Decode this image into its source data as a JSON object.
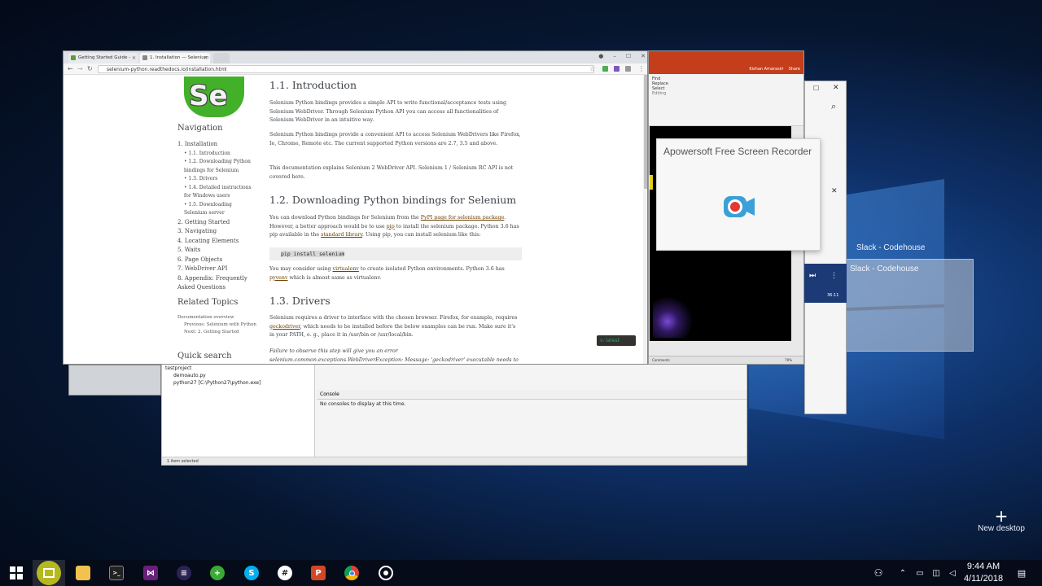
{
  "chrome": {
    "tabs": [
      {
        "label": "Getting Started Guide -"
      },
      {
        "label": "1. Installation — Selenium"
      }
    ],
    "url": "selenium-python.readthedocs.io/installation.html",
    "version_badge": "v: latest"
  },
  "sidebar": {
    "logo_text": "Se",
    "navigation_heading": "Navigation",
    "nav_items": [
      {
        "label": "1. Installation",
        "sub": [
          "1.1. Introduction",
          "1.2. Downloading Python bindings for Selenium",
          "1.3. Drivers",
          "1.4. Detailed instructions for Windows users",
          "1.5. Downloading Selenium server"
        ]
      },
      {
        "label": "2. Getting Started"
      },
      {
        "label": "3. Navigating"
      },
      {
        "label": "4. Locating Elements"
      },
      {
        "label": "5. Waits"
      },
      {
        "label": "6. Page Objects"
      },
      {
        "label": "7. WebDriver API"
      },
      {
        "label": "8. Appendix: Frequently Asked Questions"
      }
    ],
    "related_heading": "Related Topics",
    "related_overview": "Documentation overview",
    "related_prev": "Previous: Selenium with Python",
    "related_next": "Next: 2. Getting Started",
    "quick_search_heading": "Quick search"
  },
  "content": {
    "h_intro": "1.1. Introduction",
    "p_intro_1": "Selenium Python bindings provides a simple API to write functional/acceptance tests using Selenium WebDriver. Through Selenium Python API you can access all functionalities of Selenium WebDriver in an intuitive way.",
    "p_intro_2": "Selenium Python bindings provide a convenient API to access Selenium WebDrivers like Firefox, Ie, Chrome, Remote etc. The current supported Python versions are 2.7, 3.5 and above.",
    "p_intro_3": "This documentation explains Selenium 2 WebDriver API. Selenium 1 / Selenium RC API is not covered here.",
    "h_download": "1.2. Downloading Python bindings for Selenium",
    "p_download_1a": "You can download Python bindings for Selenium from the ",
    "p_download_1_link": "PyPI page for selenium package",
    "p_download_1b": ". However, a better approach would be to use ",
    "p_download_1_link2": "pip",
    "p_download_1c": " to install the selenium package. Python 3.6 has pip available in the ",
    "p_download_1_link3": "standard library",
    "p_download_1d": ". Using pip, you can install selenium like this:",
    "code": "pip install selenium",
    "p_download_2a": "You may consider using ",
    "p_download_2_link": "virtualenv",
    "p_download_2b": " to create isolated Python environments. Python 3.6 has ",
    "p_download_2_link2": "pyvenv",
    "p_download_2c": " which is almost same as virtualenv.",
    "h_drivers": "1.3. Drivers",
    "p_drivers_1a": "Selenium requires a driver to interface with the chosen browser. Firefox, for example, requires ",
    "p_drivers_1_link": "geckodriver",
    "p_drivers_1b": ", which needs to be installed before the below examples can be run. Make sure it's in your PATH, e. g., place it in /usr/bin or /usr/local/bin.",
    "p_drivers_2": "Failure to observe this step will give you an error selenium.common.exceptions.WebDriverException: Message: 'geckodriver' executable needs to be in"
  },
  "eclipse": {
    "tree": [
      "testproject",
      "demoauto.py",
      "python27 [C:\\Python27\\python.exe]"
    ],
    "console_tab": "Console",
    "console_text": "No consoles to display at this time.",
    "status": "1 item selected"
  },
  "ppt": {
    "user": "Kishan Amarasiri",
    "share": "Share",
    "ribbon": [
      "Find",
      "Replace",
      "Select",
      "Editing"
    ],
    "status_comments": "Comments",
    "status_zoom": "79%"
  },
  "recorder": {
    "title": "Apowersoft Free Screen Recorder"
  },
  "slack": {
    "label_1": "Slack - Codehouse",
    "label_2": "Slack - Codehouse",
    "media_time": "36:11"
  },
  "desktop": {
    "new_desktop": "New desktop"
  },
  "taskbar": {
    "apps": [
      "start-icon",
      "task-view-icon",
      "file-explorer-icon",
      "terminal-icon",
      "visual-studio-icon",
      "eclipse-icon",
      "greenshot-icon",
      "skype-icon",
      "slack-icon",
      "powerpoint-icon",
      "chrome-icon",
      "recorder-icon"
    ],
    "time": "9:44 AM",
    "date": "4/11/2018"
  }
}
